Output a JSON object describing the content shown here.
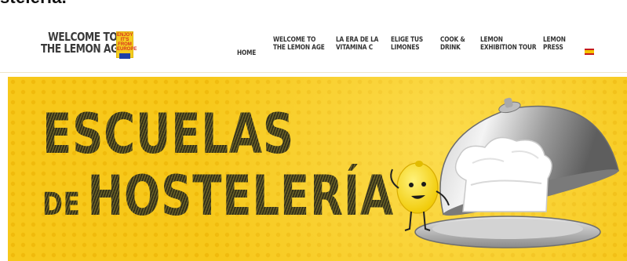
{
  "page_fragment": "stelería.",
  "logo": {
    "line1": "WELCOME TO",
    "line2": "THE LEMON AGE",
    "badge": [
      "ENJOY",
      "IT'S FROM",
      "EUROPE"
    ]
  },
  "nav": [
    {
      "label": "HOME"
    },
    {
      "label": "WELCOME TO\nTHE LEMON AGE"
    },
    {
      "label": "LA ERA DE LA\nVITAMINA C"
    },
    {
      "label": "ELIGE TUS\nLIMONES"
    },
    {
      "label": "COOK &\nDRINK"
    },
    {
      "label": "LEMON\nEXHIBITION TOUR"
    },
    {
      "label": "LEMON\nPRESS"
    }
  ],
  "language_flag": "spain-flag",
  "hero": {
    "line1": "Escuelas",
    "line2_small": "de",
    "line2_big": "Hostelería",
    "colors": {
      "background": "#f7c81a",
      "title": "#3a3620"
    }
  }
}
